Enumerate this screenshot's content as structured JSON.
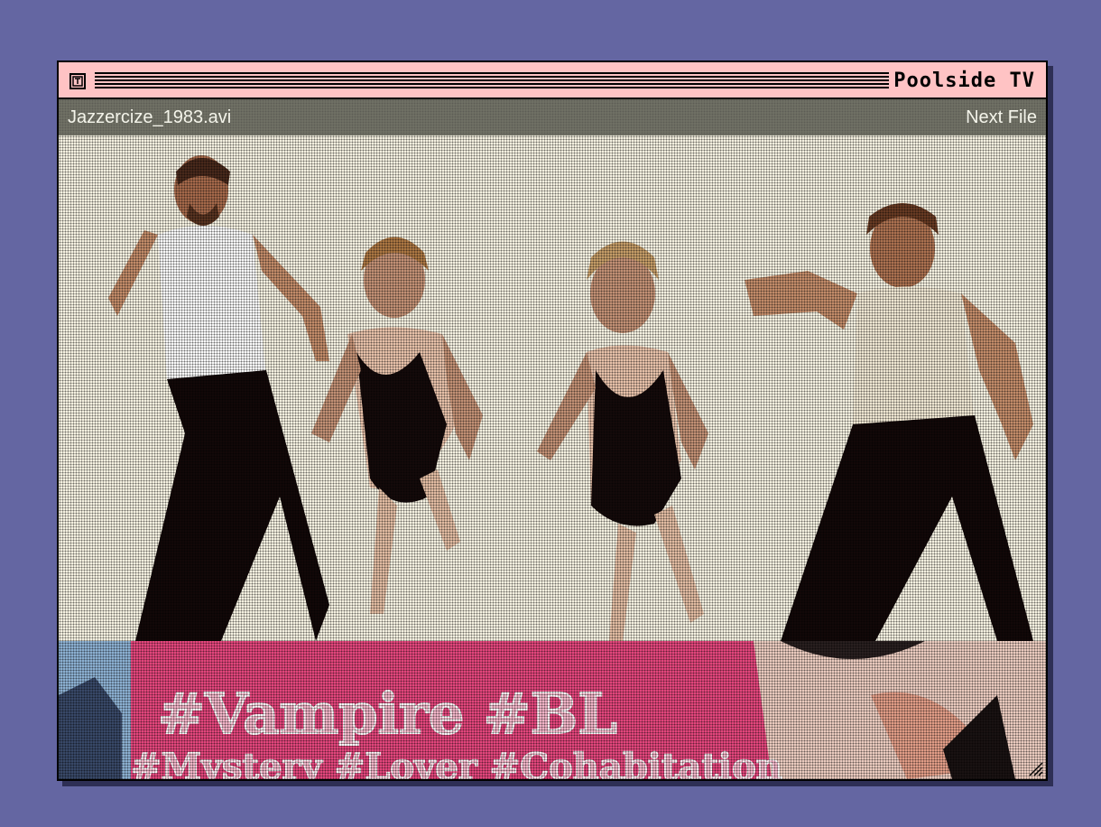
{
  "window": {
    "title": "Poolside TV",
    "close_icon": "close-box-icon",
    "titlebar_color": "#ffc3c4"
  },
  "infobar": {
    "file_name": "Jazzercize_1983.avi",
    "next_label": "Next File"
  },
  "video": {
    "caption_main": "#Vampire #BL",
    "caption_sub": "#Mystery #Lover #Cohabitation"
  },
  "colors": {
    "desktop": "#6466a2",
    "banner_pink": "#e8487f"
  }
}
